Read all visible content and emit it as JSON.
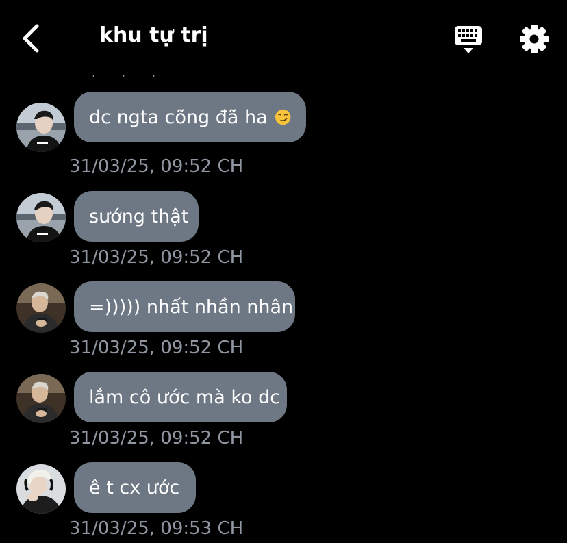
{
  "header": {
    "title": "khu tự trị",
    "back_icon": "chevron-left-icon",
    "keyboard_icon": "keyboard-icon",
    "settings_icon": "gear-icon"
  },
  "messages": [
    {
      "text": "dc ngta cõng đã ha",
      "emoji": "smirk-emoji",
      "timestamp": "31/03/25, 09:52 CH",
      "avatar": "avatar-user-a"
    },
    {
      "text": "sướng thật",
      "timestamp": "31/03/25, 09:52 CH",
      "avatar": "avatar-user-a"
    },
    {
      "text": "=))))) nhất nhần nhân",
      "timestamp": "31/03/25, 09:52 CH",
      "avatar": "avatar-user-b"
    },
    {
      "text": "lắm cô ước mà ko dc",
      "timestamp": "31/03/25, 09:52 CH",
      "avatar": "avatar-user-b"
    },
    {
      "text": "ê t cx ước",
      "timestamp": "31/03/25, 09:53 CH",
      "avatar": "avatar-user-c"
    }
  ],
  "colors": {
    "background": "#000000",
    "bubble": "#6d7884",
    "timestamp": "#8f96a2",
    "text": "#ffffff"
  }
}
